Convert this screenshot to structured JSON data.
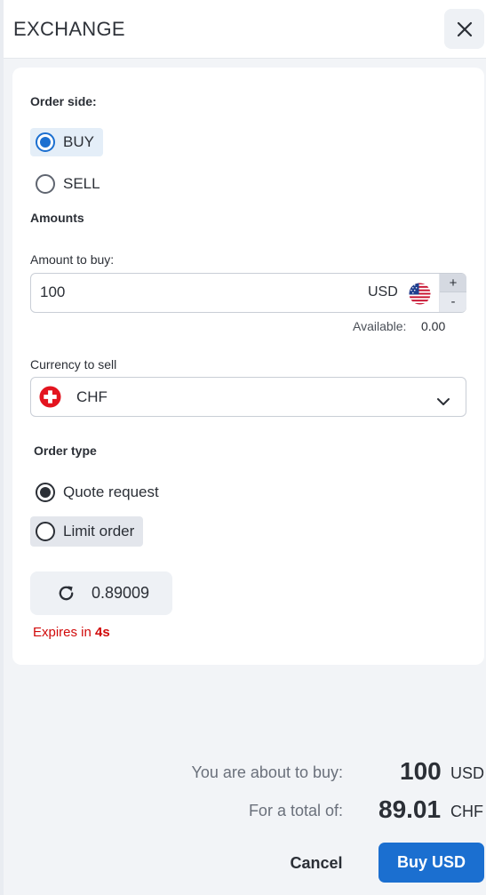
{
  "header": {
    "title": "EXCHANGE"
  },
  "order_side": {
    "label": "Order side:",
    "options": [
      {
        "label": "BUY",
        "selected": true
      },
      {
        "label": "SELL",
        "selected": false
      }
    ]
  },
  "amounts": {
    "section_label": "Amounts",
    "amount_label": "Amount to buy:",
    "amount_value": "100",
    "currency": "USD",
    "currency_flag": "us-flag-icon",
    "stepper_plus": "+",
    "stepper_minus": "-",
    "available_label": "Available:",
    "available_value": "0.00"
  },
  "currency_to_sell": {
    "label": "Currency to sell",
    "value": "CHF",
    "flag": "swiss-flag-icon"
  },
  "order_type": {
    "label": "Order type",
    "options": [
      {
        "label": "Quote request",
        "selected": true
      },
      {
        "label": "Limit order",
        "selected": false
      }
    ]
  },
  "quote": {
    "rate": "0.89009",
    "expires_prefix": "Expires in",
    "expires_value": "4s"
  },
  "summary": {
    "buy_label": "You are about to buy:",
    "buy_amount": "100",
    "buy_currency": "USD",
    "total_label": "For a total of:",
    "total_amount": "89.01",
    "total_currency": "CHF"
  },
  "actions": {
    "cancel_label": "Cancel",
    "buy_label": "Buy USD"
  },
  "colors": {
    "accent": "#1b6fd0",
    "error": "#d10a0a",
    "page_bg": "#f2f4f7"
  }
}
